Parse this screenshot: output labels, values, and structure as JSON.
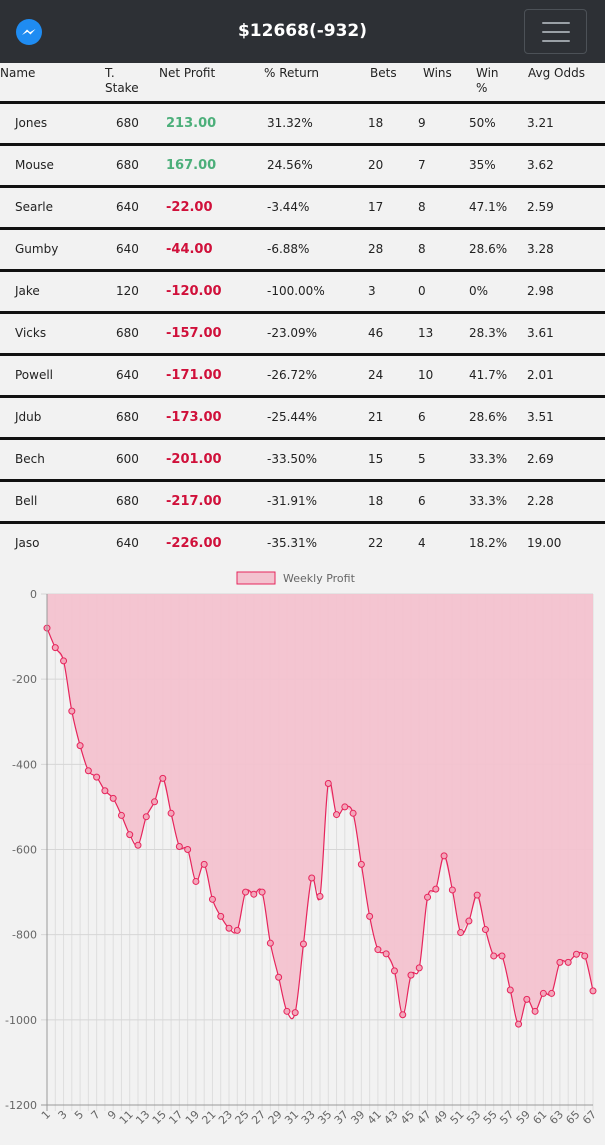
{
  "header": {
    "title": "$12668(-932)",
    "logo_icon": "messenger-icon",
    "menu_icon": "hamburger-menu-icon"
  },
  "table": {
    "columns": [
      "Name",
      "T. Stake",
      "Net Profit",
      "% Return",
      "Bets",
      "Wins",
      "Win %",
      "Avg Odds"
    ],
    "rows": [
      {
        "name": "Jones",
        "stake": "680",
        "profit": "213.00",
        "return": "31.32%",
        "bets": "18",
        "wins": "9",
        "win_pct": "50%",
        "avg_odds": "3.21"
      },
      {
        "name": "Mouse",
        "stake": "680",
        "profit": "167.00",
        "return": "24.56%",
        "bets": "20",
        "wins": "7",
        "win_pct": "35%",
        "avg_odds": "3.62"
      },
      {
        "name": "Searle",
        "stake": "640",
        "profit": "-22.00",
        "return": "-3.44%",
        "bets": "17",
        "wins": "8",
        "win_pct": "47.1%",
        "avg_odds": "2.59"
      },
      {
        "name": "Gumby",
        "stake": "640",
        "profit": "-44.00",
        "return": "-6.88%",
        "bets": "28",
        "wins": "8",
        "win_pct": "28.6%",
        "avg_odds": "3.28"
      },
      {
        "name": "Jake",
        "stake": "120",
        "profit": "-120.00",
        "return": "-100.00%",
        "bets": "3",
        "wins": "0",
        "win_pct": "0%",
        "avg_odds": "2.98"
      },
      {
        "name": "Vicks",
        "stake": "680",
        "profit": "-157.00",
        "return": "-23.09%",
        "bets": "46",
        "wins": "13",
        "win_pct": "28.3%",
        "avg_odds": "3.61"
      },
      {
        "name": "Powell",
        "stake": "640",
        "profit": "-171.00",
        "return": "-26.72%",
        "bets": "24",
        "wins": "10",
        "win_pct": "41.7%",
        "avg_odds": "2.01"
      },
      {
        "name": "Jdub",
        "stake": "680",
        "profit": "-173.00",
        "return": "-25.44%",
        "bets": "21",
        "wins": "6",
        "win_pct": "28.6%",
        "avg_odds": "3.51"
      },
      {
        "name": "Bech",
        "stake": "600",
        "profit": "-201.00",
        "return": "-33.50%",
        "bets": "15",
        "wins": "5",
        "win_pct": "33.3%",
        "avg_odds": "2.69"
      },
      {
        "name": "Bell",
        "stake": "680",
        "profit": "-217.00",
        "return": "-31.91%",
        "bets": "18",
        "wins": "6",
        "win_pct": "33.3%",
        "avg_odds": "2.28"
      },
      {
        "name": "Jaso",
        "stake": "640",
        "profit": "-226.00",
        "return": "-35.31%",
        "bets": "22",
        "wins": "4",
        "win_pct": "18.2%",
        "avg_odds": "19.00"
      }
    ]
  },
  "chart_data": {
    "type": "area",
    "title": "",
    "xlabel": "",
    "ylabel": "",
    "ylim": [
      -1200,
      0
    ],
    "yticks": [
      "0",
      "-200",
      "-400",
      "-600",
      "-800",
      "-1000",
      "-1200"
    ],
    "grid": true,
    "legend": "top-center",
    "series": [
      {
        "name": "Weekly Profit",
        "color": "#e6255c",
        "fill": "#f3c2cf",
        "x": [
          1,
          2,
          3,
          4,
          5,
          6,
          7,
          8,
          9,
          10,
          11,
          12,
          13,
          14,
          15,
          16,
          17,
          18,
          19,
          20,
          21,
          22,
          23,
          24,
          25,
          26,
          27,
          28,
          29,
          30,
          31,
          32,
          33,
          34,
          35,
          36,
          37,
          38,
          39,
          40,
          41,
          42,
          43,
          44,
          45,
          46,
          47,
          48,
          49,
          50,
          51,
          52,
          53,
          54,
          55,
          56,
          57,
          58,
          59,
          60,
          61,
          62,
          63,
          64,
          65,
          66,
          67
        ],
        "values": [
          -80,
          -126,
          -157,
          -275,
          -356,
          -415,
          -430,
          -462,
          -480,
          -520,
          -565,
          -590,
          -523,
          -488,
          -433,
          -515,
          -593,
          -600,
          -675,
          -635,
          -717,
          -757,
          -785,
          -790,
          -700,
          -705,
          -700,
          -820,
          -900,
          -980,
          -983,
          -822,
          -667,
          -710,
          -445,
          -518,
          -500,
          -515,
          -635,
          -757,
          -835,
          -845,
          -885,
          -988,
          -895,
          -878,
          -712,
          -693,
          -615,
          -695,
          -795,
          -768,
          -707,
          -788,
          -850,
          -850,
          -930,
          -1010,
          -952,
          -980,
          -938,
          -938,
          -865,
          -865,
          -846,
          -850,
          -932
        ]
      }
    ]
  }
}
